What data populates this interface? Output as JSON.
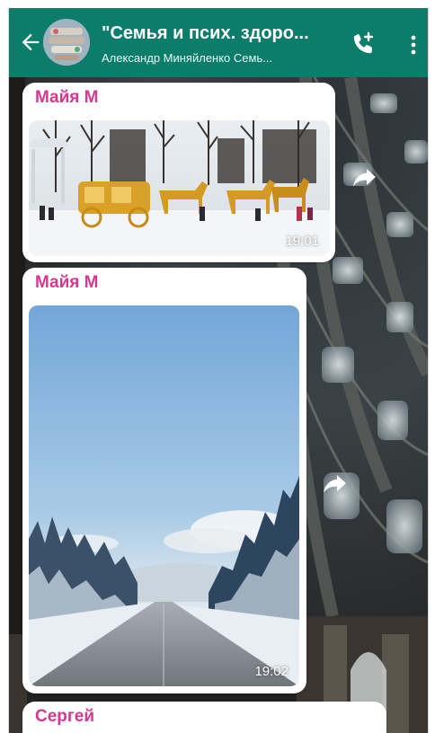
{
  "header": {
    "title": "\"Семья и псих. здоро...",
    "subtitle": "Александр Миняйленко Семь..."
  },
  "messages": [
    {
      "sender": "Майя М",
      "time": "19:01"
    },
    {
      "sender": "Майя М",
      "time": "19:02"
    },
    {
      "sender": "Сергей"
    }
  ],
  "colors": {
    "header": "#0b7d6a",
    "sender": "#d6388f"
  },
  "icons": [
    "back-arrow-icon",
    "group-avatar",
    "add-call-icon",
    "more-vert-icon",
    "forward-icon"
  ]
}
